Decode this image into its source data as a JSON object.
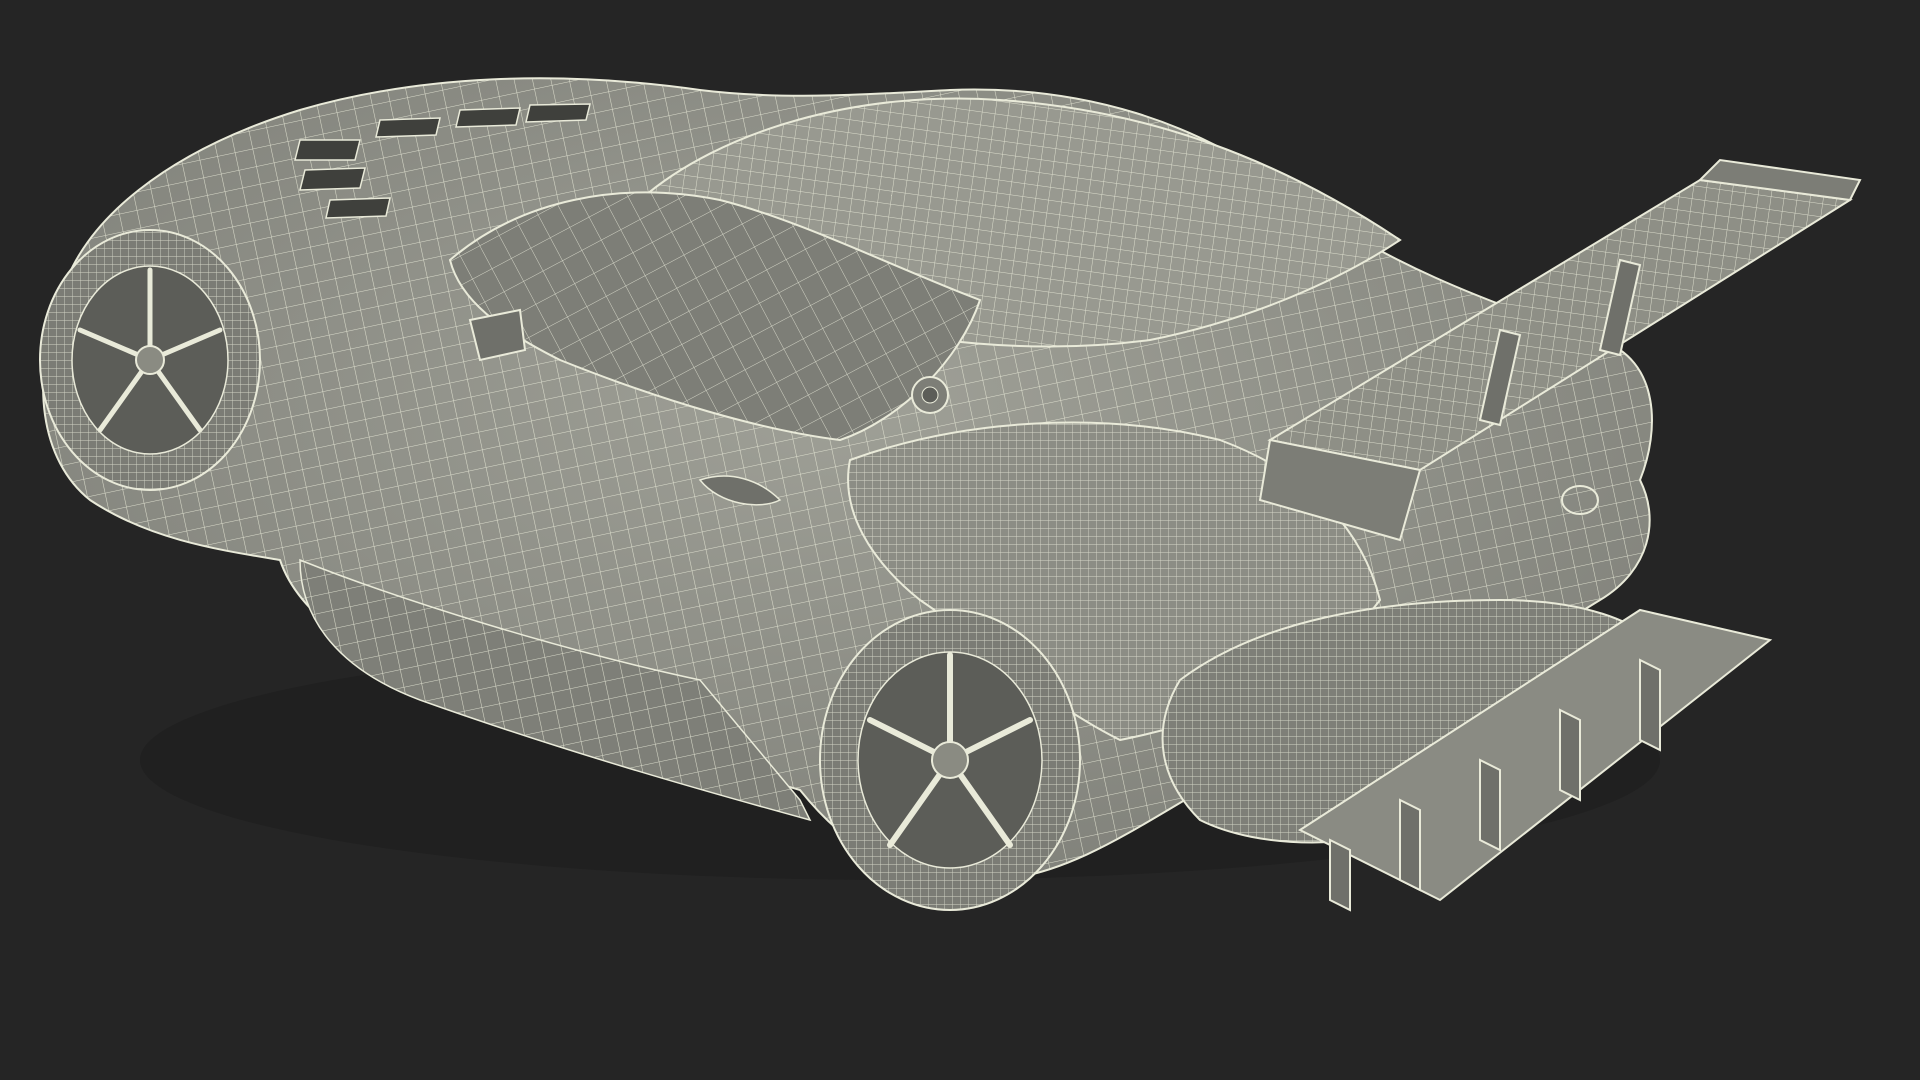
{
  "scene": {
    "subject": "race-car-wireframe",
    "view": "rear-three-quarter",
    "colors": {
      "background": "#252525",
      "surface": "#8e8f86",
      "surface_light": "#a6a79d",
      "surface_shadow": "#6f706a",
      "wire": "#e9ead9",
      "tire": "#7b7c75",
      "rim": "#8a8b82"
    }
  }
}
